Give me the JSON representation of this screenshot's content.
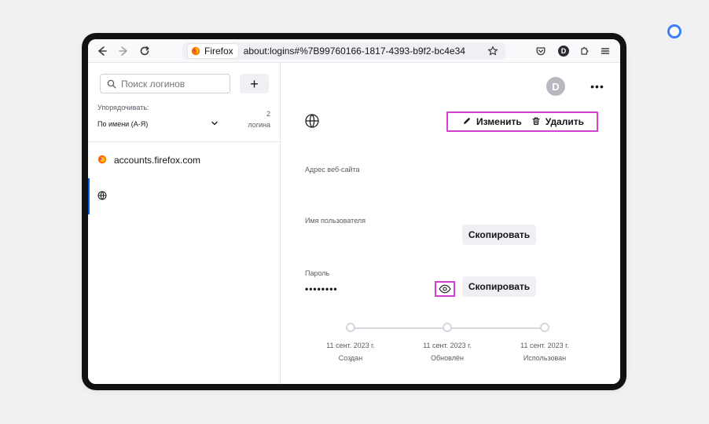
{
  "toolbar": {
    "identity_label": "Firefox",
    "url": "about:logins#%7B99760166-1817-4393-b9f2-bc4e34",
    "account_initial": "D",
    "icons": {
      "back": "back-arrow-icon",
      "forward": "forward-arrow-icon",
      "reload": "reload-icon",
      "bookmark": "star-icon",
      "pocket": "pocket-icon",
      "extensions": "puzzle-icon",
      "menu": "hamburger-menu-icon"
    }
  },
  "sidebar": {
    "search_placeholder": "Поиск логинов",
    "add_label": "+",
    "sort_label": "Упорядочивать:",
    "sort_value": "По имени (А-Я)",
    "count_number": "2",
    "count_label": "логина",
    "items": [
      {
        "label": "accounts.firefox.com",
        "icon": "firefox-icon"
      },
      {
        "label": "",
        "icon": "globe-icon"
      }
    ]
  },
  "detail": {
    "avatar_initial": "D",
    "more_label": "•••",
    "edit_label": "Изменить",
    "delete_label": "Удалить",
    "website_label": "Адрес веб-сайта",
    "username_label": "Имя пользователя",
    "password_label": "Пароль",
    "password_masked": "••••••••",
    "copy_username_label": "Скопировать",
    "copy_password_label": "Скопировать",
    "timeline": [
      {
        "date": "11 сент. 2023 г.",
        "label": "Создан"
      },
      {
        "date": "11 сент. 2023 г.",
        "label": "Обновлён"
      },
      {
        "date": "11 сент. 2023 г.",
        "label": "Использован"
      }
    ]
  },
  "colors": {
    "accent": "#0061e0",
    "highlight": "#d63fd3",
    "page_background": "#f1f1f3",
    "device_frame": "#111111"
  }
}
